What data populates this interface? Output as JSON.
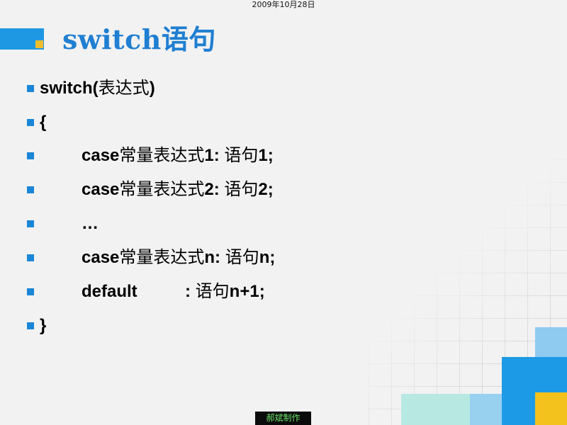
{
  "date": "2009年10月28日",
  "title": "switch语句",
  "lines": [
    {
      "parts": [
        "switch(",
        "表达式",
        ")"
      ]
    },
    {
      "parts": [
        "{"
      ]
    },
    {
      "parts": [
        "case",
        "常量表达式",
        "1:  ",
        "语句",
        "1;"
      ]
    },
    {
      "parts": [
        "case",
        "常量表达式",
        "2:  ",
        "语句",
        "2;"
      ]
    },
    {
      "parts": [
        "…"
      ]
    },
    {
      "parts": [
        "case",
        "常量表达式",
        "n:  ",
        "语句",
        "n;"
      ]
    },
    {
      "parts": [
        "default",
        ":  ",
        "语句",
        "n+1;"
      ]
    },
    {
      "parts": [
        "}"
      ]
    }
  ],
  "footer": "郝斌制作",
  "colors": {
    "title": "#1f7fd2",
    "bullet": "#1a86d8",
    "accent_bar": "#1f98e3",
    "accent_square": "#f2bd2b",
    "footer_text": "#6ce36c",
    "footer_bg": "#0b0b0b"
  }
}
